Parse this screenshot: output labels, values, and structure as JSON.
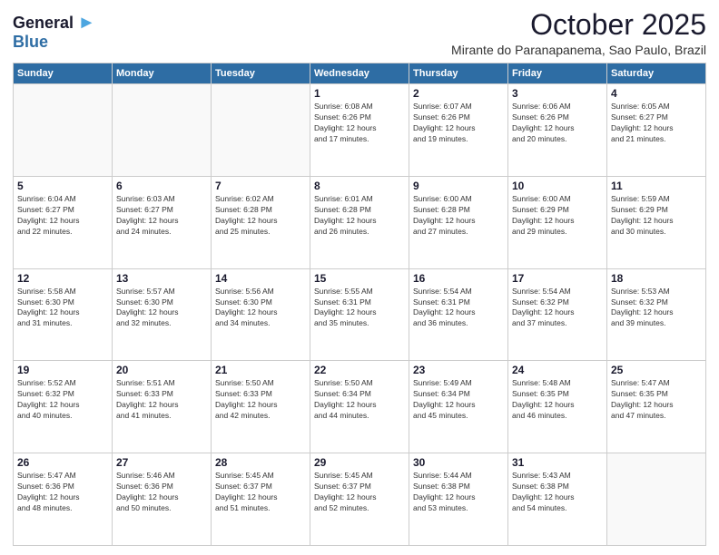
{
  "logo": {
    "line1": "General",
    "line2": "Blue"
  },
  "title": "October 2025",
  "location": "Mirante do Paranapanema, Sao Paulo, Brazil",
  "days_header": [
    "Sunday",
    "Monday",
    "Tuesday",
    "Wednesday",
    "Thursday",
    "Friday",
    "Saturday"
  ],
  "weeks": [
    [
      {
        "day": "",
        "text": ""
      },
      {
        "day": "",
        "text": ""
      },
      {
        "day": "",
        "text": ""
      },
      {
        "day": "1",
        "text": "Sunrise: 6:08 AM\nSunset: 6:26 PM\nDaylight: 12 hours\nand 17 minutes."
      },
      {
        "day": "2",
        "text": "Sunrise: 6:07 AM\nSunset: 6:26 PM\nDaylight: 12 hours\nand 19 minutes."
      },
      {
        "day": "3",
        "text": "Sunrise: 6:06 AM\nSunset: 6:26 PM\nDaylight: 12 hours\nand 20 minutes."
      },
      {
        "day": "4",
        "text": "Sunrise: 6:05 AM\nSunset: 6:27 PM\nDaylight: 12 hours\nand 21 minutes."
      }
    ],
    [
      {
        "day": "5",
        "text": "Sunrise: 6:04 AM\nSunset: 6:27 PM\nDaylight: 12 hours\nand 22 minutes."
      },
      {
        "day": "6",
        "text": "Sunrise: 6:03 AM\nSunset: 6:27 PM\nDaylight: 12 hours\nand 24 minutes."
      },
      {
        "day": "7",
        "text": "Sunrise: 6:02 AM\nSunset: 6:28 PM\nDaylight: 12 hours\nand 25 minutes."
      },
      {
        "day": "8",
        "text": "Sunrise: 6:01 AM\nSunset: 6:28 PM\nDaylight: 12 hours\nand 26 minutes."
      },
      {
        "day": "9",
        "text": "Sunrise: 6:00 AM\nSunset: 6:28 PM\nDaylight: 12 hours\nand 27 minutes."
      },
      {
        "day": "10",
        "text": "Sunrise: 6:00 AM\nSunset: 6:29 PM\nDaylight: 12 hours\nand 29 minutes."
      },
      {
        "day": "11",
        "text": "Sunrise: 5:59 AM\nSunset: 6:29 PM\nDaylight: 12 hours\nand 30 minutes."
      }
    ],
    [
      {
        "day": "12",
        "text": "Sunrise: 5:58 AM\nSunset: 6:30 PM\nDaylight: 12 hours\nand 31 minutes."
      },
      {
        "day": "13",
        "text": "Sunrise: 5:57 AM\nSunset: 6:30 PM\nDaylight: 12 hours\nand 32 minutes."
      },
      {
        "day": "14",
        "text": "Sunrise: 5:56 AM\nSunset: 6:30 PM\nDaylight: 12 hours\nand 34 minutes."
      },
      {
        "day": "15",
        "text": "Sunrise: 5:55 AM\nSunset: 6:31 PM\nDaylight: 12 hours\nand 35 minutes."
      },
      {
        "day": "16",
        "text": "Sunrise: 5:54 AM\nSunset: 6:31 PM\nDaylight: 12 hours\nand 36 minutes."
      },
      {
        "day": "17",
        "text": "Sunrise: 5:54 AM\nSunset: 6:32 PM\nDaylight: 12 hours\nand 37 minutes."
      },
      {
        "day": "18",
        "text": "Sunrise: 5:53 AM\nSunset: 6:32 PM\nDaylight: 12 hours\nand 39 minutes."
      }
    ],
    [
      {
        "day": "19",
        "text": "Sunrise: 5:52 AM\nSunset: 6:32 PM\nDaylight: 12 hours\nand 40 minutes."
      },
      {
        "day": "20",
        "text": "Sunrise: 5:51 AM\nSunset: 6:33 PM\nDaylight: 12 hours\nand 41 minutes."
      },
      {
        "day": "21",
        "text": "Sunrise: 5:50 AM\nSunset: 6:33 PM\nDaylight: 12 hours\nand 42 minutes."
      },
      {
        "day": "22",
        "text": "Sunrise: 5:50 AM\nSunset: 6:34 PM\nDaylight: 12 hours\nand 44 minutes."
      },
      {
        "day": "23",
        "text": "Sunrise: 5:49 AM\nSunset: 6:34 PM\nDaylight: 12 hours\nand 45 minutes."
      },
      {
        "day": "24",
        "text": "Sunrise: 5:48 AM\nSunset: 6:35 PM\nDaylight: 12 hours\nand 46 minutes."
      },
      {
        "day": "25",
        "text": "Sunrise: 5:47 AM\nSunset: 6:35 PM\nDaylight: 12 hours\nand 47 minutes."
      }
    ],
    [
      {
        "day": "26",
        "text": "Sunrise: 5:47 AM\nSunset: 6:36 PM\nDaylight: 12 hours\nand 48 minutes."
      },
      {
        "day": "27",
        "text": "Sunrise: 5:46 AM\nSunset: 6:36 PM\nDaylight: 12 hours\nand 50 minutes."
      },
      {
        "day": "28",
        "text": "Sunrise: 5:45 AM\nSunset: 6:37 PM\nDaylight: 12 hours\nand 51 minutes."
      },
      {
        "day": "29",
        "text": "Sunrise: 5:45 AM\nSunset: 6:37 PM\nDaylight: 12 hours\nand 52 minutes."
      },
      {
        "day": "30",
        "text": "Sunrise: 5:44 AM\nSunset: 6:38 PM\nDaylight: 12 hours\nand 53 minutes."
      },
      {
        "day": "31",
        "text": "Sunrise: 5:43 AM\nSunset: 6:38 PM\nDaylight: 12 hours\nand 54 minutes."
      },
      {
        "day": "",
        "text": ""
      }
    ]
  ]
}
